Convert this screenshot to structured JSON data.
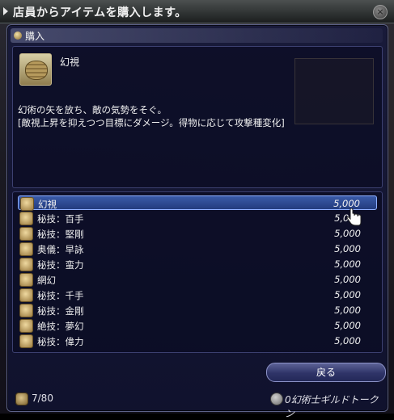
{
  "titlebar": {
    "text": "店員からアイテムを購入します。"
  },
  "window": {
    "header_title": "購入"
  },
  "item": {
    "name": "幻視",
    "desc_line1": "幻術の矢を放ち、敵の気勢をそぐ。",
    "desc_line2": "[敵視上昇を抑えつつ目標にダメージ。得物に応じて攻撃種変化]"
  },
  "shop_list": [
    {
      "name": "幻視",
      "price": "5,000",
      "selected": true
    },
    {
      "name": "秘技：百手",
      "price": "5,000",
      "selected": false
    },
    {
      "name": "秘技：堅剛",
      "price": "5,000",
      "selected": false
    },
    {
      "name": "奥儀：早詠",
      "price": "5,000",
      "selected": false
    },
    {
      "name": "秘技：蛮力",
      "price": "5,000",
      "selected": false
    },
    {
      "name": "網幻",
      "price": "5,000",
      "selected": false
    },
    {
      "name": "秘技：千手",
      "price": "5,000",
      "selected": false
    },
    {
      "name": "秘技：金剛",
      "price": "5,000",
      "selected": false
    },
    {
      "name": "絶技：夢幻",
      "price": "5,000",
      "selected": false
    },
    {
      "name": "秘技：偉力",
      "price": "5,000",
      "selected": false
    }
  ],
  "buttons": {
    "back_label": "戻る"
  },
  "footer": {
    "inventory_count": "7/80",
    "currency": "0幻術士ギルドトークン"
  },
  "colors": {
    "window_bg": "#18183a",
    "selected_row": "#2f4c9a",
    "border": "#5d6288"
  },
  "icons": {
    "close": "close-icon",
    "item": "bowl-icon",
    "bag": "bag-icon",
    "token": "token-icon",
    "cursor": "hand-cursor-icon"
  }
}
